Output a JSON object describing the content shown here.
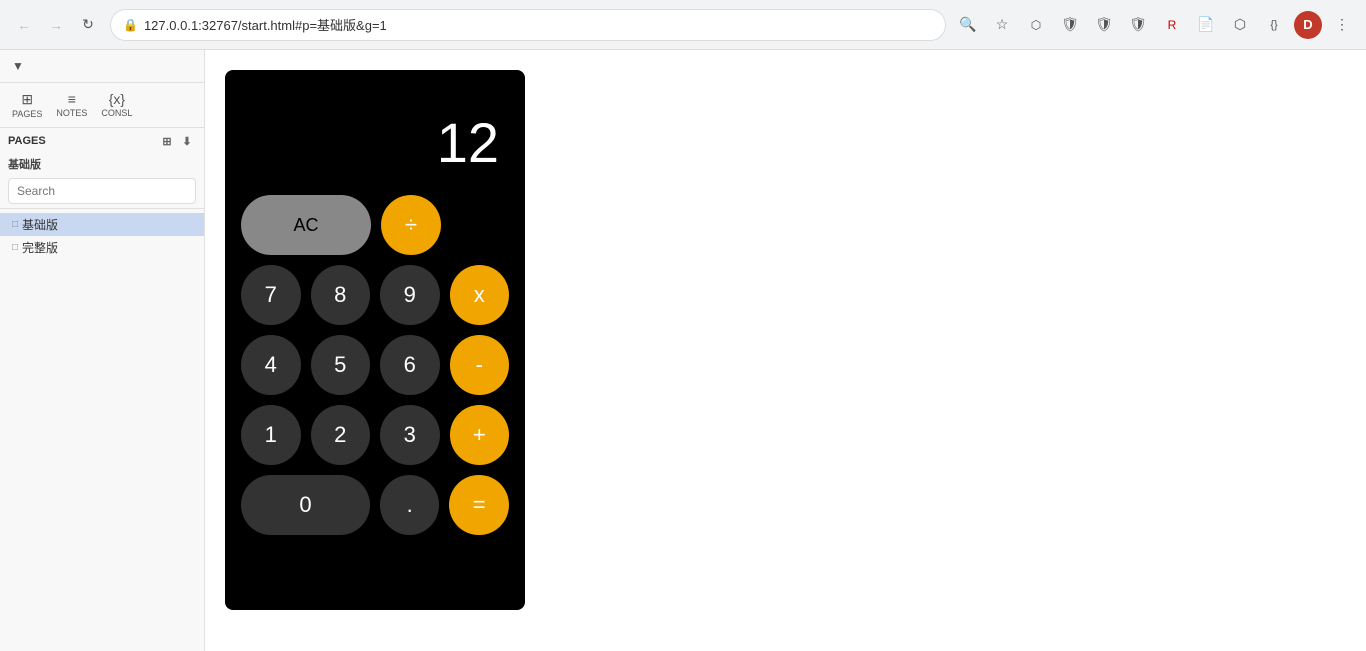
{
  "browser": {
    "url": "127.0.0.1:32767/start.html#p=基础版&g=1",
    "back_disabled": true,
    "forward_disabled": true,
    "profile_letter": "D"
  },
  "sidebar": {
    "collapse_icon": "▼",
    "pages_label": "PAGES",
    "pages_header": "基础版",
    "search_placeholder": "Search",
    "pages": [
      {
        "label": "基础版",
        "active": true
      },
      {
        "label": "完整版",
        "active": false
      }
    ],
    "nav_items": [
      {
        "icon": "⊞",
        "label": "PAGES"
      },
      {
        "icon": "≡",
        "label": "NOTES"
      },
      {
        "icon": "{x}",
        "label": "CONSL"
      }
    ]
  },
  "calculator": {
    "display": "12",
    "buttons": {
      "ac": "AC",
      "divide": "÷",
      "seven": "7",
      "eight": "8",
      "nine": "9",
      "multiply": "x",
      "four": "4",
      "five": "5",
      "six": "6",
      "minus": "-",
      "one": "1",
      "two": "2",
      "three": "3",
      "plus": "+",
      "zero": "0",
      "dot": ".",
      "equals": "="
    }
  }
}
